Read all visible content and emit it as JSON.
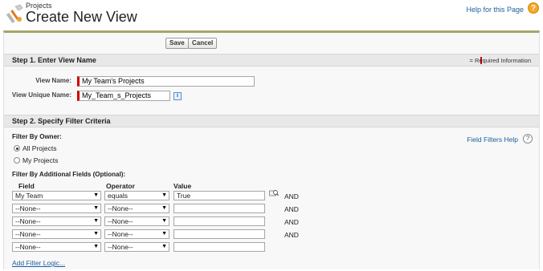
{
  "header": {
    "object_name": "Projects",
    "title": "Create New View",
    "help_link": "Help for this Page",
    "help_icon": "help-circle-icon"
  },
  "buttons": {
    "save": "Save",
    "cancel": "Cancel"
  },
  "step1": {
    "title": "Step 1. Enter View Name",
    "required_info": "= Required Information",
    "view_name_label": "View Name:",
    "view_name_value": "My Team's Projects",
    "unique_name_label": "View Unique Name:",
    "unique_name_value": "My_Team_s_Projects",
    "info_icon": "i"
  },
  "step2": {
    "title": "Step 2. Specify Filter Criteria",
    "field_filters_help": "Field Filters Help",
    "filter_by_owner_label": "Filter By Owner:",
    "owner_options": [
      {
        "label": "All Projects",
        "checked": true
      },
      {
        "label": "My Projects",
        "checked": false
      }
    ],
    "additional_fields_label": "Filter By Additional Fields (Optional):",
    "columns": {
      "field": "Field",
      "operator": "Operator",
      "value": "Value"
    },
    "filters": [
      {
        "field": "My Team",
        "operator": "equals",
        "value": "True",
        "connector": "AND",
        "lookup": true
      },
      {
        "field": "--None--",
        "operator": "--None--",
        "value": "",
        "connector": "AND",
        "lookup": false
      },
      {
        "field": "--None--",
        "operator": "--None--",
        "value": "",
        "connector": "AND",
        "lookup": false
      },
      {
        "field": "--None--",
        "operator": "--None--",
        "value": "",
        "connector": "AND",
        "lookup": false
      },
      {
        "field": "--None--",
        "operator": "--None--",
        "value": "",
        "connector": "",
        "lookup": false
      }
    ],
    "add_filter_logic": "Add Filter Logic...",
    "dropdown_arrow": "▼"
  },
  "colors": {
    "accent_bar": "#a8a56b",
    "required": "#cc0000",
    "link": "#1b5f9e"
  }
}
